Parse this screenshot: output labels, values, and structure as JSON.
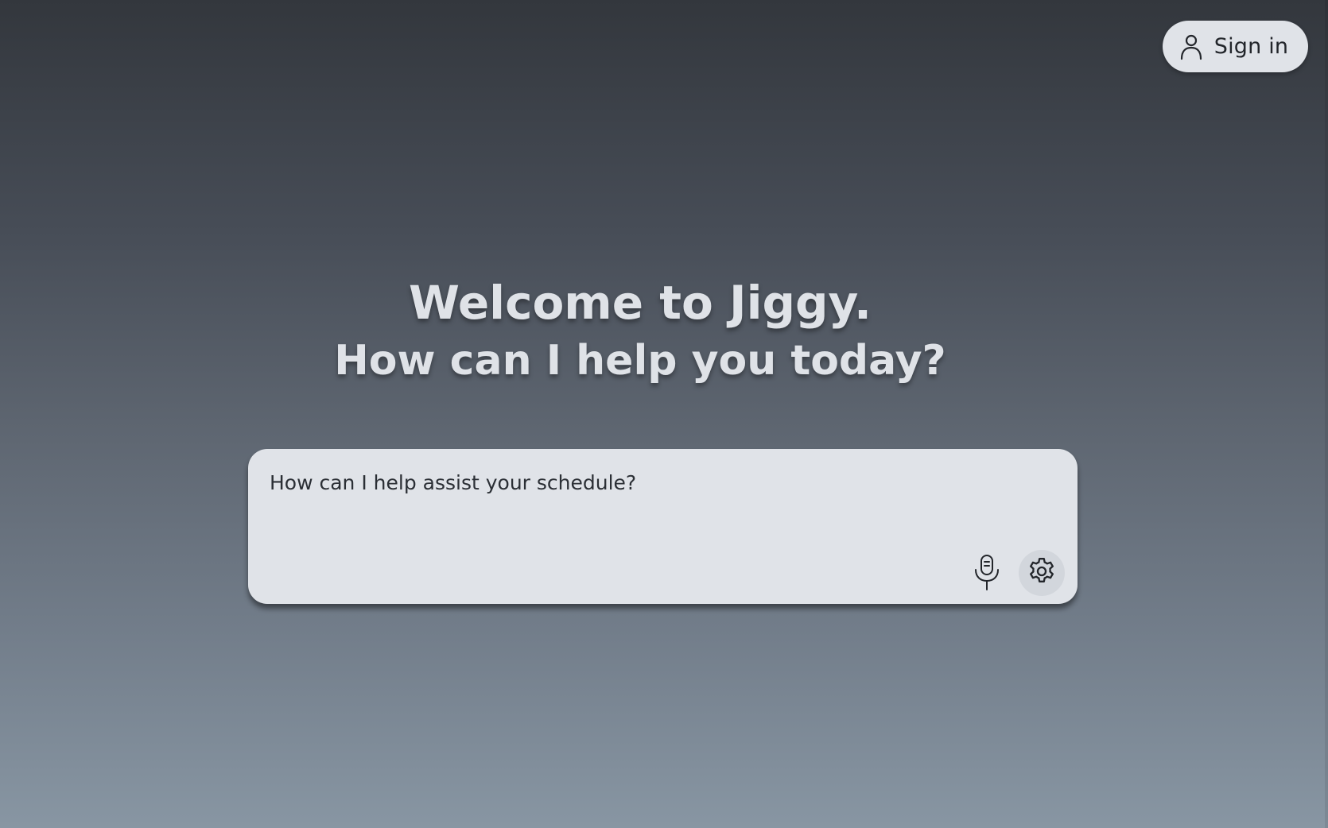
{
  "header": {
    "signin_label": "Sign in",
    "signin_icon": "user-icon"
  },
  "hero": {
    "title": "Welcome to Jiggy.",
    "subtitle": "How can I help you today?"
  },
  "composer": {
    "placeholder": "How can I help assist your schedule?",
    "value": "",
    "mic_icon": "microphone-icon",
    "settings_icon": "gear-icon"
  },
  "colors": {
    "background_top": "#33373d",
    "background_bottom": "#8896a3",
    "surface": "#e0e3e8",
    "text_dark": "#23262b",
    "hero_text": "#dfe2e7"
  }
}
